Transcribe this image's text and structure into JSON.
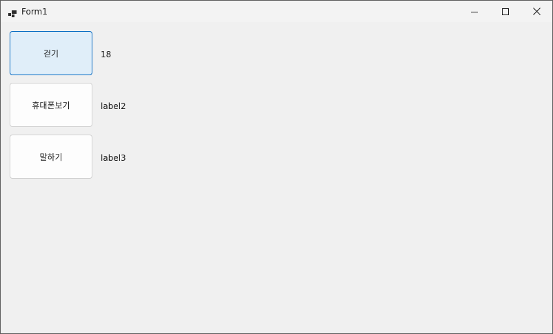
{
  "window": {
    "title": "Form1",
    "icon": "form-app-icon"
  },
  "caption_buttons": {
    "minimize_icon": "minimize-icon",
    "maximize_icon": "maximize-icon",
    "close_icon": "close-icon"
  },
  "buttons": [
    {
      "label": "걷기",
      "focused": true
    },
    {
      "label": "휴대폰보기",
      "focused": false
    },
    {
      "label": "말하기",
      "focused": false
    }
  ],
  "labels": [
    {
      "text": "18"
    },
    {
      "text": "label2"
    },
    {
      "text": "label3"
    }
  ],
  "colors": {
    "focus_border": "#0067c0",
    "focus_fill": "#e0eef9",
    "form_background": "#f0f0f0"
  }
}
